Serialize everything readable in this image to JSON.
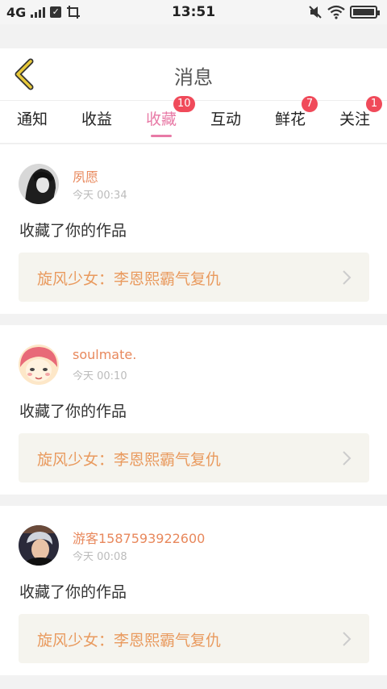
{
  "status_bar": {
    "network": "4G",
    "time": "13:51"
  },
  "header": {
    "title": "消息",
    "back_icon": "chevron-left-icon",
    "accent_color": "#e8c93a"
  },
  "tabs": [
    {
      "label": "通知",
      "badge": ""
    },
    {
      "label": "收益",
      "badge": ""
    },
    {
      "label": "收藏",
      "badge": "10",
      "active": true
    },
    {
      "label": "互动",
      "badge": ""
    },
    {
      "label": "鲜花",
      "badge": "7"
    },
    {
      "label": "关注",
      "badge": "1"
    }
  ],
  "messages": [
    {
      "username": "夙愿",
      "time": "今天 00:34",
      "action": "收藏了你的作品",
      "work_title": "旋风少女：李恩熙霸气复仇",
      "avatar": "dark-anime-avatar"
    },
    {
      "username": "soulmate.",
      "time": "今天 00:10",
      "action": "收藏了你的作品",
      "work_title": "旋风少女：李恩熙霸气复仇",
      "avatar": "pink-hair-anime-avatar"
    },
    {
      "username": "游客1587593922600",
      "time": "今天 00:08",
      "action": "收藏了你的作品",
      "work_title": "旋风少女：李恩熙霸气复仇",
      "avatar": "person-photo-avatar"
    }
  ],
  "colors": {
    "active_tab": "#e87aa6",
    "username": "#e8885c",
    "work_title": "#e99a5e",
    "badge": "#f04a5a"
  }
}
